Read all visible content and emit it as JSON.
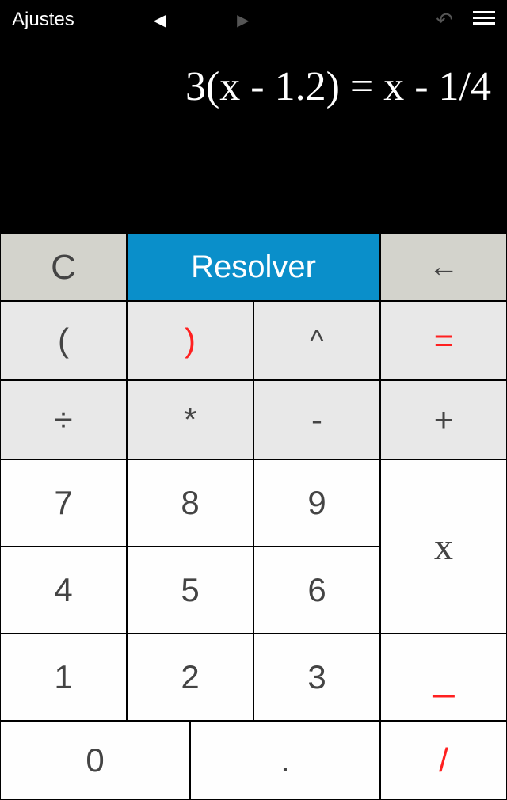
{
  "topbar": {
    "settings_label": "Ajustes",
    "nav_left_icon": "◀",
    "nav_right_icon": "▶",
    "undo_icon": "↶",
    "menu_icon": "☰"
  },
  "display": {
    "expression": "3(x - 1.2) = x - 1/4"
  },
  "keypad": {
    "clear": "C",
    "solve": "Resolver",
    "backspace": "←",
    "open_paren": "(",
    "close_paren": ")",
    "caret": "^",
    "equals": "=",
    "divide": "÷",
    "multiply": "*",
    "minus": "-",
    "plus": "+",
    "d7": "7",
    "d8": "8",
    "d9": "9",
    "d4": "4",
    "d5": "5",
    "d6": "6",
    "d1": "1",
    "d2": "2",
    "d3": "3",
    "d0": "0",
    "dot": ".",
    "slash": "/",
    "var_x": "x",
    "underscore": "_"
  }
}
